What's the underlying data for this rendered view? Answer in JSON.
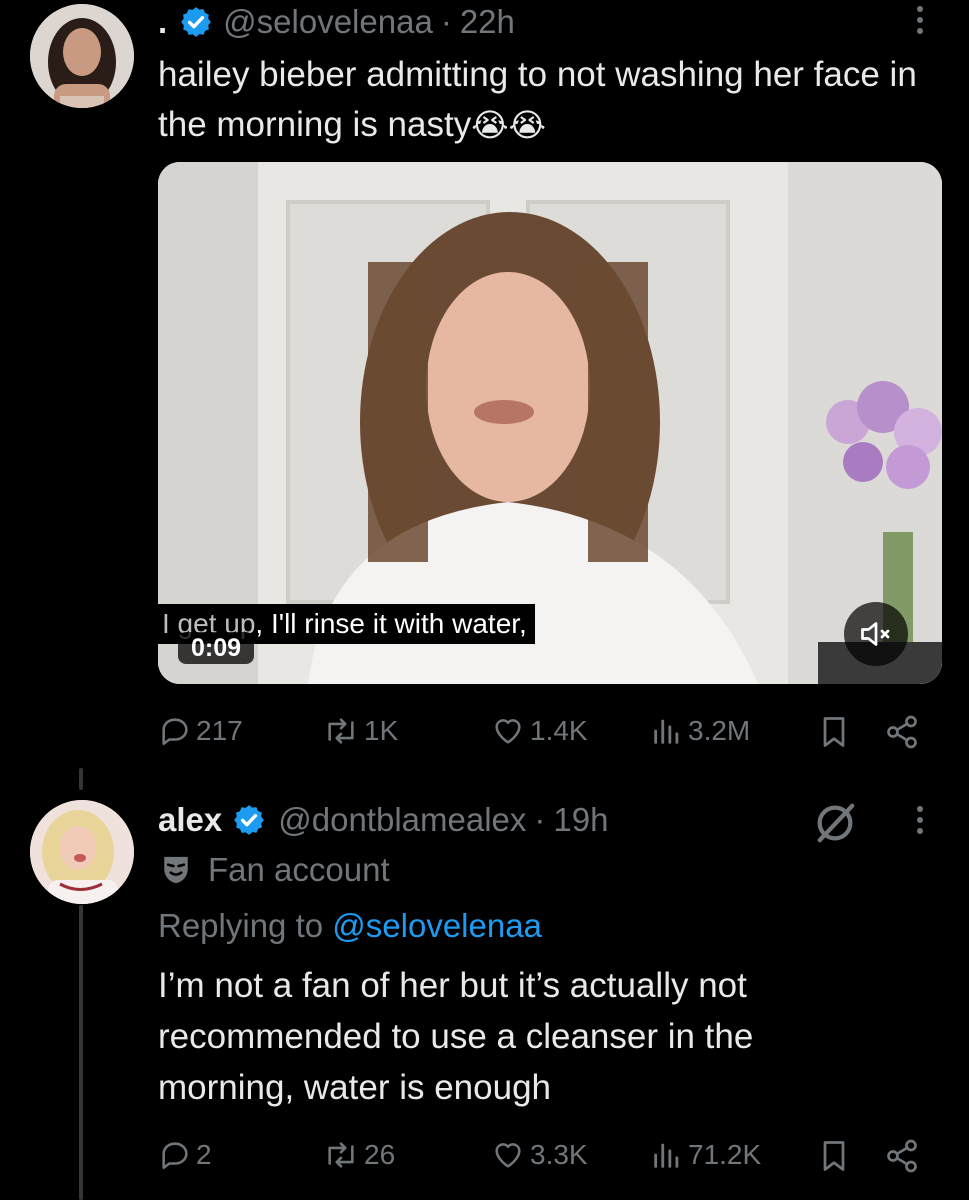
{
  "tweet": {
    "display_name": ".",
    "handle": "@selovelenaa",
    "time": "22h",
    "text": "hailey bieber admitting to not washing her face in the morning is nasty",
    "emoji": "😭😭",
    "video": {
      "caption_part1": "I get up",
      "caption_part2": ", I'll rinse it with water,",
      "timestamp": "0:09",
      "muted": true
    },
    "stats": {
      "replies": "217",
      "reposts": "1K",
      "likes": "1.4K",
      "views": "3.2M"
    }
  },
  "reply": {
    "display_name": "alex",
    "handle": "@dontblamealex",
    "time": "19h",
    "badge_label": "Fan account",
    "replying_prefix": "Replying to",
    "replying_to": "@selovelenaa",
    "text": "I’m not a fan of her but it’s actually not recommended to use a cleanser in the morning, water is enough",
    "stats": {
      "replies": "2",
      "reposts": "26",
      "likes": "3.3K",
      "views": "71.2K"
    }
  },
  "colors": {
    "accent": "#1d9bf0",
    "muted": "#71767b",
    "background": "#000000",
    "text": "#e7e9ea"
  }
}
